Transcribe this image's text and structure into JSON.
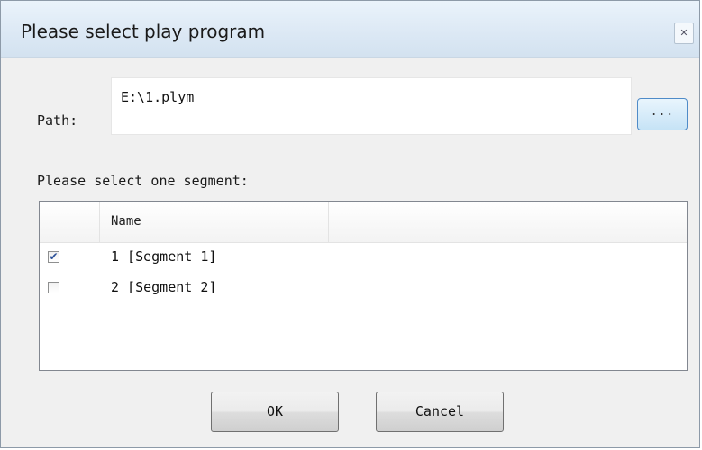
{
  "window": {
    "title": "Please select play program",
    "close_glyph": "✕"
  },
  "path": {
    "label": "Path:",
    "value": "E:\\1.plym",
    "browse_label": "..."
  },
  "segments": {
    "prompt": "Please select one segment:",
    "column_name": "Name",
    "rows": [
      {
        "label": "1 [Segment 1]",
        "checked": true,
        "check_glyph": "✔"
      },
      {
        "label": "2 [Segment 2]",
        "checked": false,
        "check_glyph": ""
      }
    ]
  },
  "buttons": {
    "ok": "OK",
    "cancel": "Cancel"
  },
  "colors": {
    "title_bar": "#dde9f5",
    "checkmark": "#2a4f98",
    "browse_border": "#4f8bc8"
  }
}
